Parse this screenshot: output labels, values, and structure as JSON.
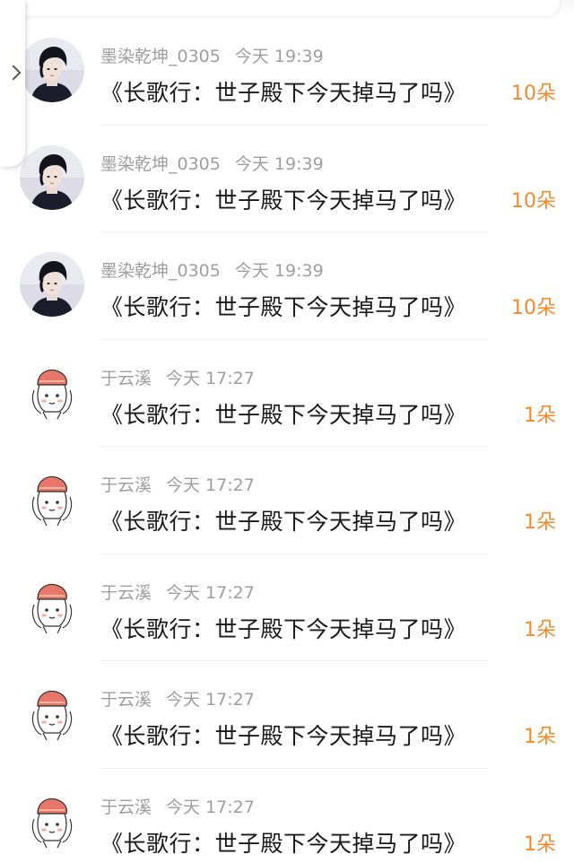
{
  "items": [
    {
      "user": "墨染乾坤_0305",
      "time": "今天 19:39",
      "title": "《长歌行：世子殿下今天掉马了吗》",
      "count": "10朵",
      "avatar": "photo-avatar"
    },
    {
      "user": "墨染乾坤_0305",
      "time": "今天 19:39",
      "title": "《长歌行：世子殿下今天掉马了吗》",
      "count": "10朵",
      "avatar": "photo-avatar"
    },
    {
      "user": "墨染乾坤_0305",
      "time": "今天 19:39",
      "title": "《长歌行：世子殿下今天掉马了吗》",
      "count": "10朵",
      "avatar": "photo-avatar"
    },
    {
      "user": "于云溪",
      "time": "今天 17:27",
      "title": "《长歌行：世子殿下今天掉马了吗》",
      "count": "1朵",
      "avatar": "cartoon-avatar"
    },
    {
      "user": "于云溪",
      "time": "今天 17:27",
      "title": "《长歌行：世子殿下今天掉马了吗》",
      "count": "1朵",
      "avatar": "cartoon-avatar"
    },
    {
      "user": "于云溪",
      "time": "今天 17:27",
      "title": "《长歌行：世子殿下今天掉马了吗》",
      "count": "1朵",
      "avatar": "cartoon-avatar"
    },
    {
      "user": "于云溪",
      "time": "今天 17:27",
      "title": "《长歌行：世子殿下今天掉马了吗》",
      "count": "1朵",
      "avatar": "cartoon-avatar"
    },
    {
      "user": "于云溪",
      "time": "今天 17:27",
      "title": "《长歌行：世子殿下今天掉马了吗》",
      "count": "1朵",
      "avatar": "cartoon-avatar"
    }
  ],
  "side_handle": {
    "icon": "chevron-right-icon"
  },
  "colors": {
    "count": "#f08a2c",
    "meta": "#9e9e9e",
    "title": "#1a1a1a"
  }
}
